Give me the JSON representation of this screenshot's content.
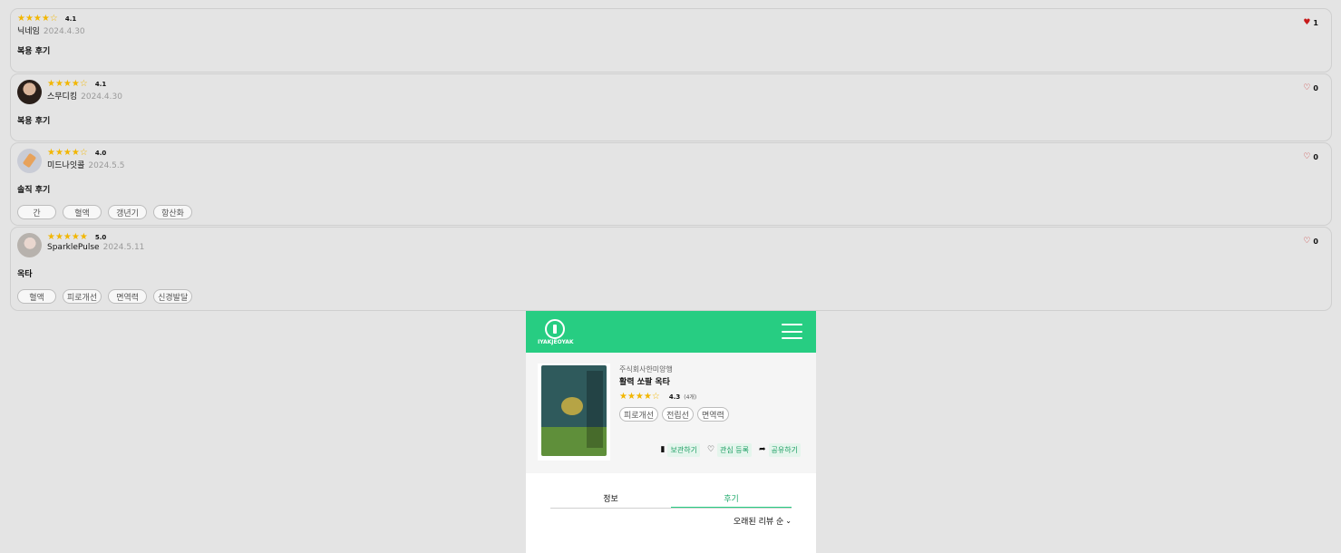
{
  "reviews": [
    {
      "stars": "★★★★☆",
      "rating": "4.1",
      "nickname": "닉네임",
      "date": "2024.4.30",
      "liked": true,
      "likes": "1",
      "title": "복용 후기",
      "tags": []
    },
    {
      "stars": "★★★★☆",
      "rating": "4.1",
      "nickname": "스무디킹",
      "date": "2024.4.30",
      "liked": false,
      "likes": "0",
      "title": "복용 후기",
      "tags": []
    },
    {
      "stars": "★★★★☆",
      "rating": "4.0",
      "nickname": "미드나잇콜",
      "date": "2024.5.5",
      "liked": false,
      "likes": "0",
      "title": "솔직 후기",
      "tags": [
        "간",
        "혈액",
        "갱년기",
        "항산화"
      ]
    },
    {
      "stars": "★★★★★",
      "rating": "5.0",
      "nickname": "SparklePulse",
      "date": "2024.5.11",
      "liked": false,
      "likes": "0",
      "title": "옥타",
      "tags": [
        "혈액",
        "피로개선",
        "면역력",
        "신경발달"
      ]
    }
  ],
  "icons": {
    "heart_filled": "♥",
    "heart_outline": "♡",
    "bookmark": "bookmark-icon",
    "share": "share-icon",
    "menu": "hamburger-menu-icon"
  },
  "app": {
    "logo_text": "IYAKJEOYAK",
    "brand_color": "#27cd82"
  },
  "product": {
    "maker": "주식회사한미양행",
    "name": "활력 쏘팔 옥타",
    "stars": "★★★★☆",
    "rating": "4.3",
    "review_count": "(4개)",
    "tags": [
      "피로개선",
      "전립선",
      "면역력"
    ],
    "actions": {
      "save": "보관하기",
      "interest": "관심 등록",
      "share": "공유하기"
    }
  },
  "tabs": {
    "info": "정보",
    "reviews": "후기",
    "active": "reviews"
  },
  "sort": {
    "label": "오래된 리뷰 순"
  }
}
